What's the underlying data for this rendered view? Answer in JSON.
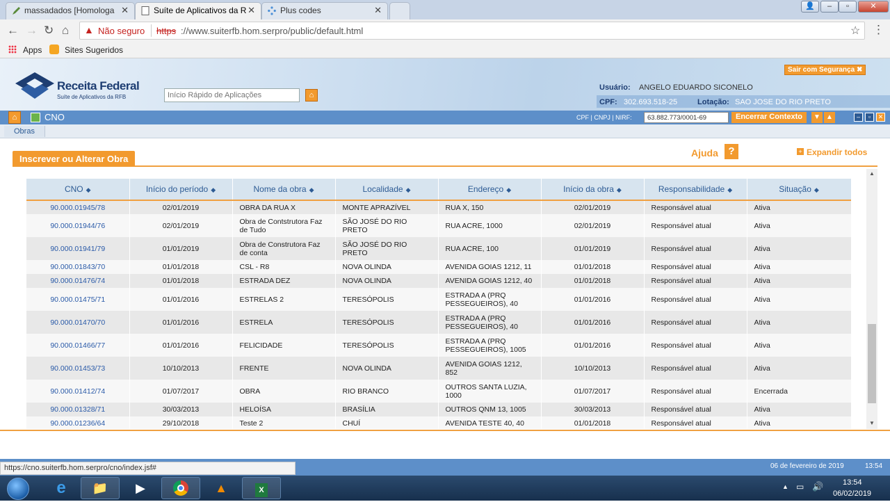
{
  "browser": {
    "tabs": [
      {
        "title": "massadados [Homologa"
      },
      {
        "title": "Suíte de Aplicativos da R"
      },
      {
        "title": "Plus codes"
      }
    ],
    "security": "Não seguro",
    "url_scheme": "https",
    "url_rest": "://www.suiterfb.hom.serpro/public/default.html",
    "bookmarks": {
      "apps": "Apps",
      "sites": "Sites Sugeridos"
    },
    "status_url": "https://cno.suiterfb.hom.serpro/cno/index.jsf#"
  },
  "header": {
    "logo_title": "Receita Federal",
    "logo_subtitle": "Suíte de Aplicativos da RFB",
    "quick_placeholder": "Início Rápido de Aplicações",
    "logout": "Sair com Segurança",
    "user_label": "Usuário:",
    "user_value": "ANGELO EDUARDO SICONELO",
    "cpf_label": "CPF:",
    "cpf_value": "302.693.518-25",
    "lotacao_label": "Lotação:",
    "lotacao_value": "SAO JOSE DO RIO PRETO"
  },
  "module": {
    "name": "CNO",
    "context_label": "CPF | CNPJ | NIRF:",
    "context_value": "63.882.773/0001-69",
    "end_context": "Encerrar Contexto",
    "submenu": "Obras"
  },
  "panel": {
    "title": "Inscrever ou Alterar Obra",
    "help": "Ajuda",
    "expand": "Expandir todos"
  },
  "table": {
    "columns": [
      "CNO",
      "Início do período",
      "Nome da obra",
      "Localidade",
      "Endereço",
      "Início da obra",
      "Responsabilidade",
      "Situação"
    ],
    "rows": [
      [
        "90.000.01945/78",
        "02/01/2019",
        "OBRA DA RUA X",
        "MONTE APRAZÍVEL",
        "RUA X, 150",
        "02/01/2019",
        "Responsável atual",
        "Ativa"
      ],
      [
        "90.000.01944/76",
        "02/01/2019",
        "Obra de Contstrutora Faz de Tudo",
        "SÃO JOSÉ DO RIO PRETO",
        "RUA ACRE, 1000",
        "02/01/2019",
        "Responsável atual",
        "Ativa"
      ],
      [
        "90.000.01941/79",
        "01/01/2019",
        "Obra de Construtora Faz de conta",
        "SÃO JOSÉ DO RIO PRETO",
        "RUA ACRE, 100",
        "01/01/2019",
        "Responsável atual",
        "Ativa"
      ],
      [
        "90.000.01843/70",
        "01/01/2018",
        "CSL - R8",
        "NOVA OLINDA",
        "AVENIDA GOIAS 1212, 11",
        "01/01/2018",
        "Responsável atual",
        "Ativa"
      ],
      [
        "90.000.01476/74",
        "01/01/2018",
        "ESTRADA DEZ",
        "NOVA OLINDA",
        "AVENIDA GOIAS 1212, 40",
        "01/01/2018",
        "Responsável atual",
        "Ativa"
      ],
      [
        "90.000.01475/71",
        "01/01/2016",
        "ESTRELAS 2",
        "TERESÓPOLIS",
        "ESTRADA A (PRQ PESSEGUEIROS), 40",
        "01/01/2016",
        "Responsável atual",
        "Ativa"
      ],
      [
        "90.000.01470/70",
        "01/01/2016",
        "ESTRELA",
        "TERESÓPOLIS",
        "ESTRADA A (PRQ PESSEGUEIROS), 40",
        "01/01/2016",
        "Responsável atual",
        "Ativa"
      ],
      [
        "90.000.01466/77",
        "01/01/2016",
        "FELICIDADE",
        "TERESÓPOLIS",
        "ESTRADA A (PRQ PESSEGUEIROS), 1005",
        "01/01/2016",
        "Responsável atual",
        "Ativa"
      ],
      [
        "90.000.01453/73",
        "10/10/2013",
        "FRENTE",
        "NOVA OLINDA",
        "AVENIDA GOIAS 1212, 852",
        "10/10/2013",
        "Responsável atual",
        "Ativa"
      ],
      [
        "90.000.01412/74",
        "01/07/2017",
        "OBRA",
        "RIO BRANCO",
        "OUTROS SANTA LUZIA, 1000",
        "01/07/2017",
        "Responsável atual",
        "Encerrada"
      ],
      [
        "90.000.01328/71",
        "30/03/2013",
        "HELOÍSA",
        "BRASÍLIA",
        "OUTROS QNM 13, 1005",
        "30/03/2013",
        "Responsável atual",
        "Ativa"
      ],
      [
        "90.000.01236/64",
        "29/10/2018",
        "Teste 2",
        "CHUÍ",
        "AVENIDA TESTE 40, 40",
        "01/01/2018",
        "Responsável atual",
        "Ativa"
      ]
    ]
  },
  "footer": {
    "date": "06 de fevereiro de 2019",
    "time": "13:54"
  },
  "taskbar": {
    "clock_time": "13:54",
    "clock_date": "06/02/2019"
  },
  "colors": {
    "accent_orange": "#f29a2e",
    "bar_blue": "#5d8fc9",
    "link_blue": "#2a5aa8"
  }
}
